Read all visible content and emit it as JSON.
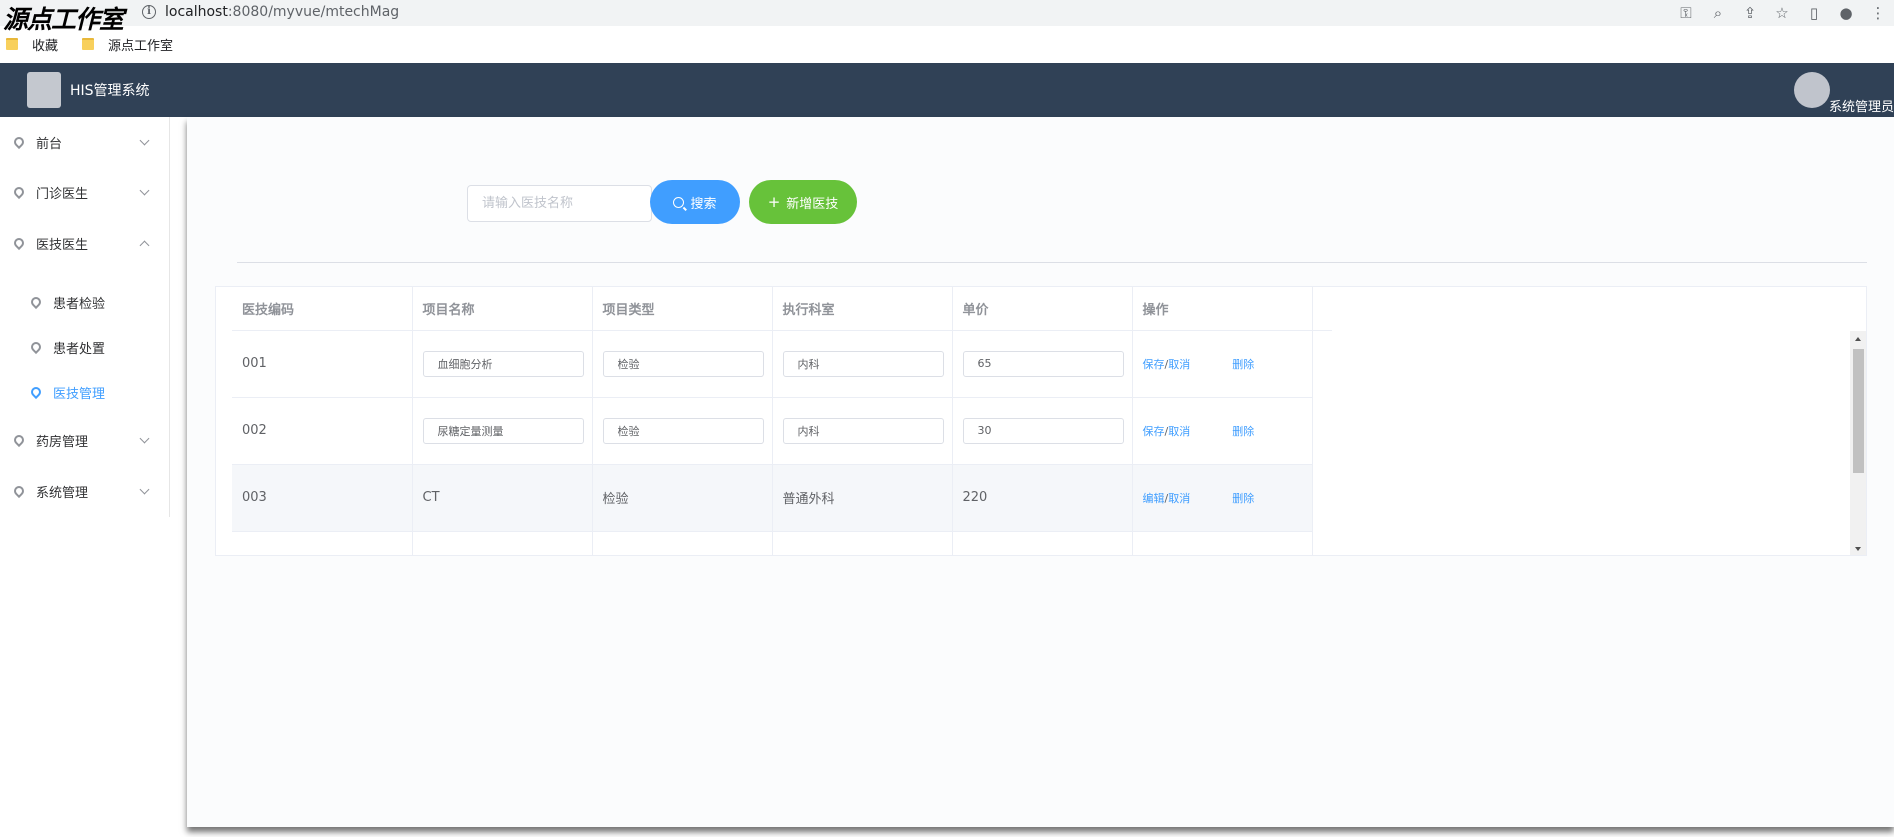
{
  "browser": {
    "watermark": "源点工作室",
    "url_host": "localhost",
    "url_rest": ":8080/myvue/mtechMag",
    "bookmarks": [
      "收藏",
      "源点工作室"
    ]
  },
  "header": {
    "title": "HIS管理系统",
    "user": "系统管理员"
  },
  "sidebar": {
    "items": [
      {
        "label": "前台"
      },
      {
        "label": "门诊医生"
      },
      {
        "label": "医技医生"
      },
      {
        "label": "患者检验"
      },
      {
        "label": "患者处置"
      },
      {
        "label": "医技管理"
      },
      {
        "label": "药房管理"
      },
      {
        "label": "系统管理"
      }
    ]
  },
  "toolbar": {
    "search_placeholder": "请输入医技名称",
    "search_label": "搜索",
    "add_label": "新增医技"
  },
  "table": {
    "columns": [
      "医技编码",
      "项目名称",
      "项目类型",
      "执行科室",
      "单价",
      "操作"
    ],
    "rows": [
      {
        "code": "001",
        "name": "血细胞分析",
        "type": "检验",
        "dept": "内科",
        "price": "65",
        "op1": "保存",
        "op2": "取消",
        "del": "删除"
      },
      {
        "code": "002",
        "name": "尿糖定量测量",
        "type": "检验",
        "dept": "内科",
        "price": "30",
        "op1": "保存",
        "op2": "取消",
        "del": "删除"
      },
      {
        "code": "003",
        "name": "CT",
        "type": "检验",
        "dept": "普通外科",
        "price": "220",
        "op1": "编辑",
        "op2": "取消",
        "del": "删除"
      }
    ],
    "separator": "/"
  }
}
